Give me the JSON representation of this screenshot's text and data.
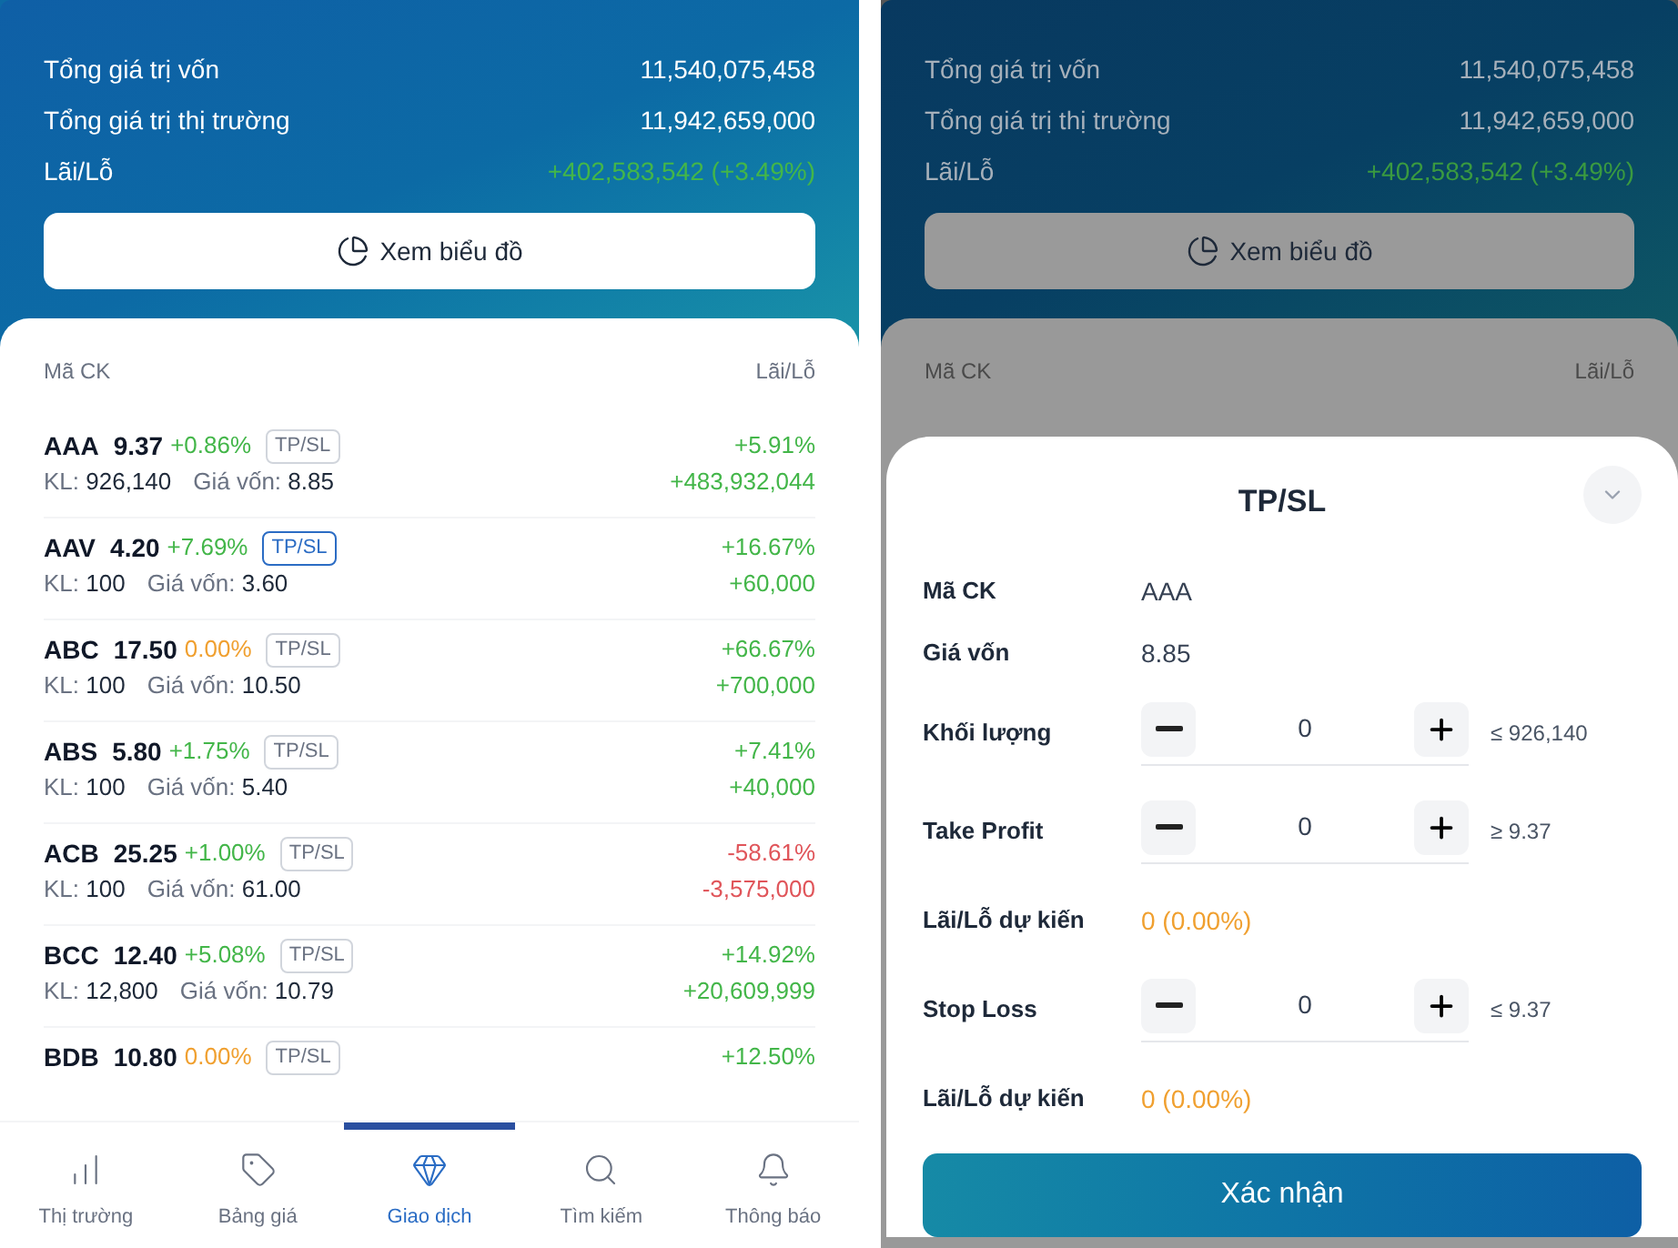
{
  "portfolio": {
    "summary": [
      {
        "label": "Tổng giá trị vốn",
        "value": "11,540,075,458",
        "color": "#ffffff"
      },
      {
        "label": "Tổng giá trị thị trường",
        "value": "11,942,659,000",
        "color": "#ffffff"
      },
      {
        "label": "Lãi/Lỗ",
        "value": "+402,583,542 (+3.49%)",
        "color": "#43b649"
      }
    ],
    "chart_button": "Xem biểu đồ",
    "list_header": {
      "symbol": "Mã CK",
      "profit": "Lãi/Lỗ"
    },
    "rows": [
      {
        "symbol": "AAA",
        "price": "9.37",
        "change": {
          "text": "+0.86%",
          "color": "#43b649"
        },
        "tpsl": "TP/SL",
        "tpsl_active": false,
        "volume": "KL: **926,140**",
        "cost": "Giá vốn: **8.85**",
        "pl": {
          "percent": "+5.91%",
          "value": "+483,932,044",
          "color": "#43b649"
        }
      },
      {
        "symbol": "AAV",
        "price": "4.20",
        "change": {
          "text": "+7.69%",
          "color": "#43b649"
        },
        "tpsl": "TP/SL",
        "tpsl_active": true,
        "volume": "KL: **100**",
        "cost": "Giá vốn: **3.60**",
        "pl": {
          "percent": "+16.67%",
          "value": "+60,000",
          "color": "#43b649"
        }
      },
      {
        "symbol": "ABC",
        "price": "17.50",
        "change": {
          "text": "0.00%",
          "color": "#f0a030"
        },
        "tpsl": "TP/SL",
        "tpsl_active": false,
        "volume": "KL: **100**",
        "cost": "Giá vốn: **10.50**",
        "pl": {
          "percent": "+66.67%",
          "value": "+700,000",
          "color": "#43b649"
        }
      },
      {
        "symbol": "ABS",
        "price": "5.80",
        "change": {
          "text": "+1.75%",
          "color": "#43b649"
        },
        "tpsl": "TP/SL",
        "tpsl_active": false,
        "volume": "KL: **100**",
        "cost": "Giá vốn: **5.40**",
        "pl": {
          "percent": "+7.41%",
          "value": "+40,000",
          "color": "#43b649"
        }
      },
      {
        "symbol": "ACB",
        "price": "25.25",
        "change": {
          "text": "+1.00%",
          "color": "#43b649"
        },
        "tpsl": "TP/SL",
        "tpsl_active": false,
        "volume": "KL: **100**",
        "cost": "Giá vốn: **61.00**",
        "pl": {
          "percent": "-58.61%",
          "value": "-3,575,000",
          "color": "#e0555a"
        }
      },
      {
        "symbol": "BCC",
        "price": "12.40",
        "change": {
          "text": "+5.08%",
          "color": "#43b649"
        },
        "tpsl": "TP/SL",
        "tpsl_active": false,
        "volume": "KL: **12,800**",
        "cost": "Giá vốn: **10.79**",
        "pl": {
          "percent": "+14.92%",
          "value": "+20,609,999",
          "color": "#43b649"
        }
      },
      {
        "symbol": "BDB",
        "price": "10.80",
        "change": {
          "text": "0.00%",
          "color": "#f0a030"
        },
        "tpsl": "TP/SL",
        "tpsl_active": false,
        "pl": {
          "percent": "+12.50%",
          "color": "#43b649"
        }
      }
    ],
    "nav": [
      {
        "label": "Thị trường",
        "selected": false
      },
      {
        "label": "Bảng giá",
        "selected": false
      },
      {
        "label": "Giao dịch",
        "selected": true
      },
      {
        "label": "Tìm kiếm",
        "selected": false
      },
      {
        "label": "Thông báo",
        "selected": false
      }
    ]
  },
  "tpsl_screen": {
    "summary": [
      {
        "label": "Tổng giá trị vốn",
        "value": "11,540,075,458",
        "color": "#a6b0ba"
      },
      {
        "label": "Tổng giá trị thị trường",
        "value": "11,942,659,000",
        "color": "#a6b0ba"
      },
      {
        "label": "Lãi/Lỗ",
        "value": "+402,583,542 (+3.49%)",
        "color": "#3a9a40"
      }
    ],
    "chart_button": "Xem biểu đồ",
    "list_header": {
      "symbol": "Mã CK",
      "profit": "Lãi/Lỗ"
    },
    "sheet": {
      "title": "TP/SL",
      "fields": [
        {
          "kind": "info",
          "label": "Mã CK",
          "value": "AAA"
        },
        {
          "kind": "info",
          "label": "Giá vốn",
          "value": "8.85"
        },
        {
          "kind": "stepper",
          "label": "Khối lượng",
          "value": "0",
          "hint": "≤ 926,140"
        },
        {
          "kind": "stepper",
          "label": "Take Profit",
          "value": "0",
          "hint": "≥ 9.37"
        },
        {
          "kind": "estimate",
          "label": "Lãi/Lỗ dự kiến",
          "value": "0 (0.00%)"
        },
        {
          "kind": "stepper",
          "label": "Stop Loss",
          "value": "0",
          "hint": "≤ 9.37"
        },
        {
          "kind": "estimate",
          "label": "Lãi/Lỗ dự kiến",
          "value": "0 (0.00%)"
        }
      ],
      "confirm": "Xác nhận"
    }
  }
}
